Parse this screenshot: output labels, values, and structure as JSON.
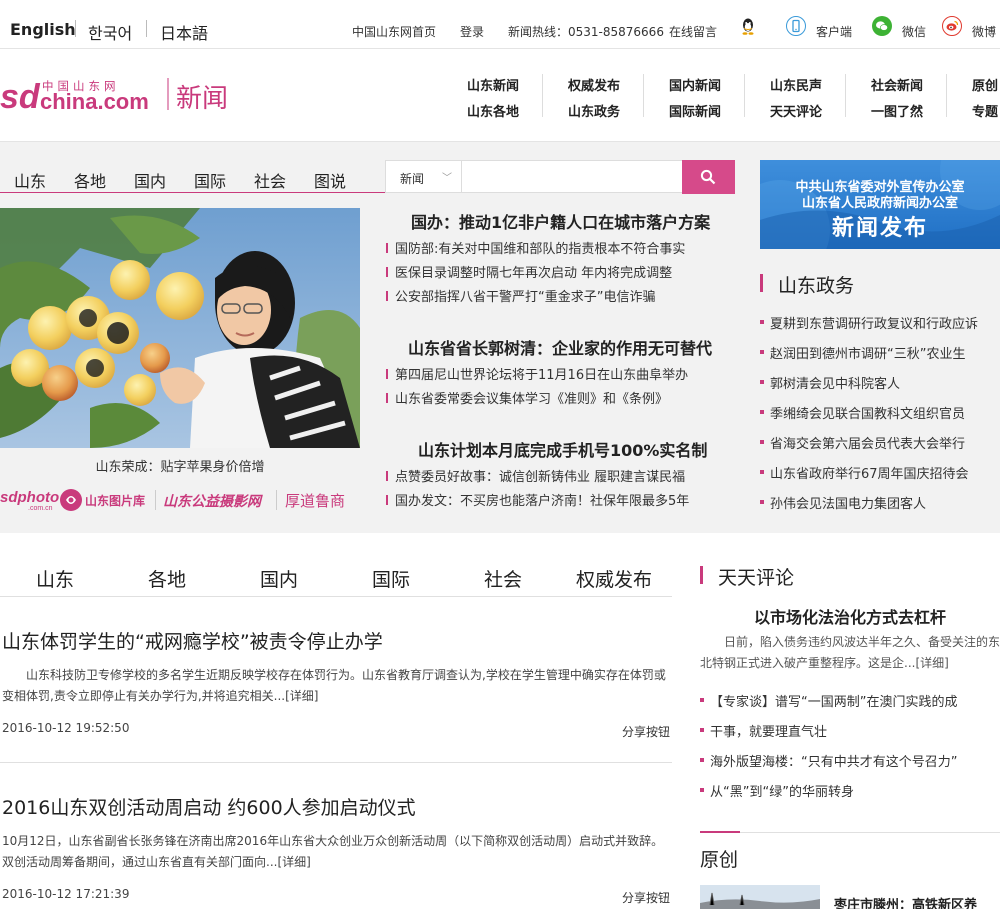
{
  "top_bar": {
    "languages": [
      "English",
      "한국어",
      "日本語"
    ],
    "links": [
      "中国山东网首页",
      "登录",
      "新闻热线：0531-85876666",
      "在线留言"
    ],
    "apps": [
      "客户端",
      "微信",
      "微博"
    ]
  },
  "header": {
    "logo_small": "中国山东网",
    "logo_main": "sdchina.com",
    "section": "新闻",
    "nav_row1": [
      "山东新闻",
      "权威发布",
      "国内新闻",
      "山东民声",
      "社会新闻",
      "原创"
    ],
    "nav_row2": [
      "山东各地",
      "山东政务",
      "国际新闻",
      "天天评论",
      "一图了然",
      "专题"
    ]
  },
  "band": {
    "tabs": [
      "山东",
      "各地",
      "国内",
      "国际",
      "社会",
      "图说"
    ],
    "search": {
      "category": "新闻",
      "placeholder": ""
    },
    "photo_caption": "山东荣成：贴字苹果身价倍增",
    "partners": [
      "sdphoto",
      ".com.cn",
      "山东图片库",
      "山东公益摄影网",
      "厚道鲁商"
    ],
    "news_groups": [
      {
        "headline": "国办：推动1亿非户籍人口在城市落户方案",
        "items": [
          "国防部:有关对中国维和部队的指责根本不符合事实",
          "医保目录调整时隔七年再次启动 年内将完成调整",
          "公安部指挥八省干警严打“重金求子”电信诈骗"
        ]
      },
      {
        "headline": "山东省省长郭树清：企业家的作用无可替代",
        "items": [
          "第四届尼山世界论坛将于11月16日在山东曲阜举办",
          "山东省委常委会议集体学习《准则》和《条例》"
        ]
      },
      {
        "headline": "山东计划本月底完成手机号100%实名制",
        "items": [
          "点赞委员好故事：诚信创新铸伟业 履职建言谋民福",
          "国办发文：不买房也能落户济南！社保年限最多5年"
        ]
      }
    ],
    "banner": {
      "line1": "中共山东省委对外宣传办公室",
      "line2": "山东省人民政府新闻办公室",
      "line3": "新闻发布"
    },
    "gov": {
      "title": "山东政务",
      "items": [
        "夏耕到东营调研行政复议和行政应诉",
        "赵润田到德州市调研“三秋”农业生",
        "郭树清会见中科院客人",
        "季缃绮会见联合国教科文组织官员",
        "省海交会第六届会员代表大会举行",
        "山东省政府举行67周年国庆招待会",
        "孙伟会见法国电力集团客人"
      ]
    }
  },
  "main": {
    "tabs": [
      "山东",
      "各地",
      "国内",
      "国际",
      "社会",
      "权威发布"
    ],
    "share_label": "分享按钮",
    "articles": [
      {
        "title": "山东体罚学生的“戒网瘾学校”被责令停止办学",
        "summary": "山东科技防卫专修学校的多名学生近期反映学校存在体罚行为。山东省教育厅调查认为,学校在学生管理中确实存在体罚或变相体罚,责令立即停止有关办学行为,并将追究相关...",
        "more": "[详细]",
        "date": "2016-10-12 19:52:50"
      },
      {
        "title": "2016山东双创活动周启动 约600人参加启动仪式",
        "summary": "10月12日，山东省副省长张务锋在济南出席2016年山东省大众创业万众创新活动周（以下简称双创活动周）启动式并致辞。双创活动周筹备期间，通过山东省直有关部门面向...",
        "more": "[详细]",
        "date": "2016-10-12 17:21:39"
      }
    ]
  },
  "commentary": {
    "title": "天天评论",
    "headline": "以市场化法治化方式去杠杆",
    "summary": "日前，陷入债务违约风波达半年之久、备受关注的东北特钢正式进入破产重整程序。这是企...",
    "more": "[详细]",
    "items": [
      "【专家谈】谱写“一国两制”在澳门实践的成",
      "干事，就要理直气壮",
      "海外版望海楼：“只有中共才有这个号召力”",
      "从“黑”到“绿”的华丽转身"
    ]
  },
  "original": {
    "title": "原创",
    "item": "枣庄市滕州：高铁新区养"
  },
  "colors": {
    "accent": "#c93a7c",
    "search_button": "#d64a8a",
    "banner_blue": "#2a7fd4"
  }
}
